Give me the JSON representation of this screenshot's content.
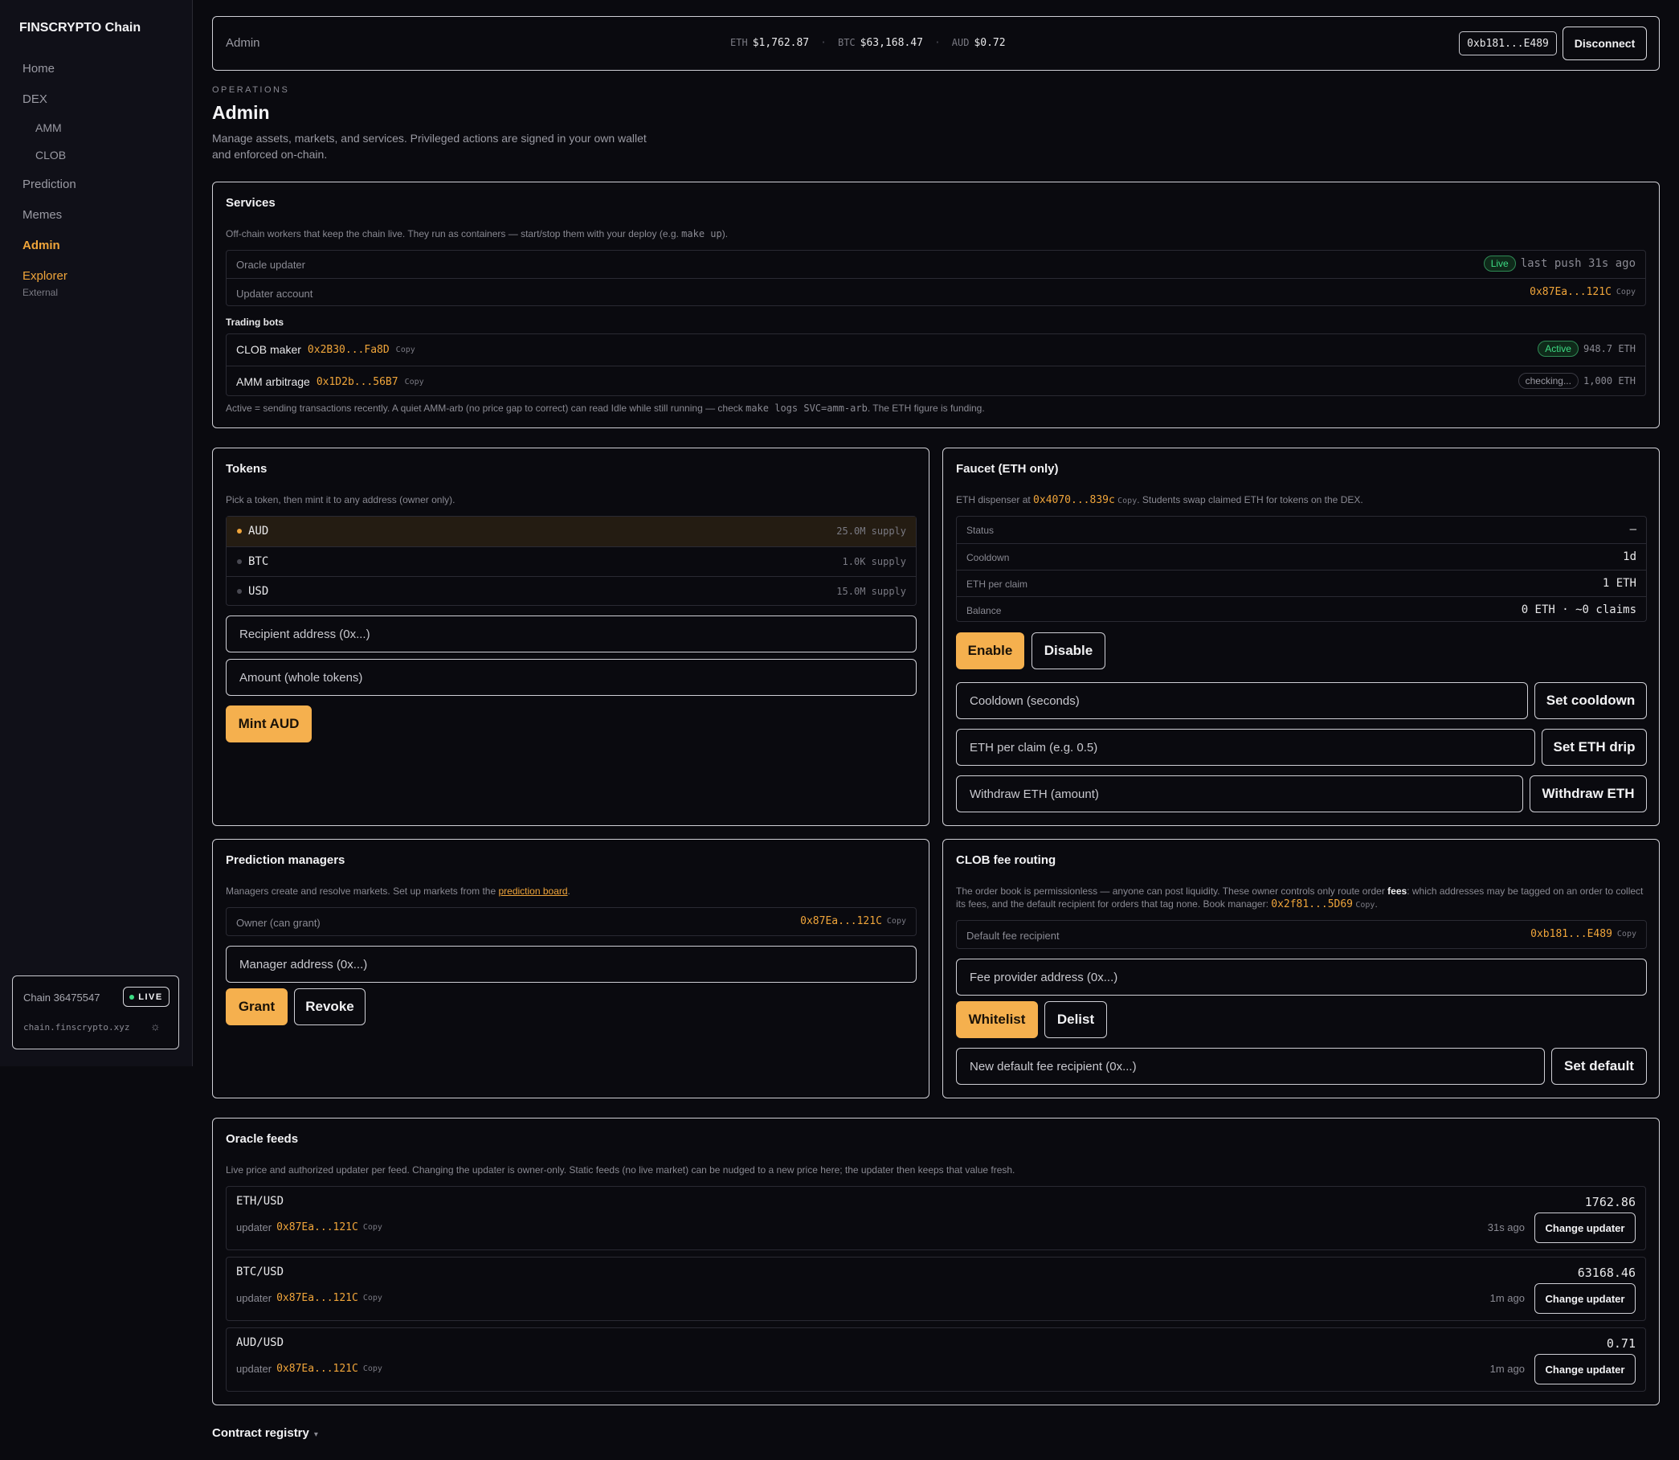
{
  "sidebar": {
    "brand": "FINSCRYPTO Chain",
    "items": [
      {
        "label": "Home"
      },
      {
        "label": "DEX"
      },
      {
        "label": "AMM"
      },
      {
        "label": "CLOB"
      },
      {
        "label": "Prediction"
      },
      {
        "label": "Memes"
      },
      {
        "label": "Admin"
      },
      {
        "label": "Explorer"
      }
    ],
    "explorer_sub": "External",
    "chain_label": "Chain 36475547",
    "live_label": "LIVE",
    "chain_host": "chain.finscrypto.xyz",
    "theme_icon": "sun-icon"
  },
  "header": {
    "title": "Admin",
    "tickers": [
      {
        "symbol": "ETH",
        "value": "$1,762.87"
      },
      {
        "symbol": "BTC",
        "value": "$63,168.47"
      },
      {
        "symbol": "AUD",
        "value": "$0.72"
      }
    ],
    "separator": "·",
    "wallet": "0xb181...E489",
    "disconnect": "Disconnect"
  },
  "page": {
    "eyebrow": "OPERATIONS",
    "title": "Admin",
    "description": "Manage assets, markets, and services. Privileged actions are signed in your own wallet and enforced on-chain."
  },
  "services": {
    "title": "Services",
    "desc_pre": "Off-chain workers that keep the chain live. They run as containers — start/stop them with your deploy (e.g. ",
    "desc_code": "make up",
    "desc_post": ").",
    "oracle_label": "Oracle updater",
    "oracle_badge": "Live",
    "oracle_status": "last push 31s ago",
    "account_label": "Updater account",
    "account_addr": "0x87Ea...121C",
    "copy": "Copy",
    "bots_title": "Trading bots",
    "bots": [
      {
        "name": "CLOB maker",
        "addr": "0x2B30...Fa8D",
        "badge": "Active",
        "funding": "948.7 ETH"
      },
      {
        "name": "AMM arbitrage",
        "addr": "0x1D2b...56B7",
        "badge": "checking...",
        "funding": "1,000 ETH"
      }
    ],
    "note_pre": "Active = sending transactions recently. A quiet AMM-arb (no price gap to correct) can read Idle while still running — check ",
    "note_code": "make logs SVC=amm-arb",
    "note_post": ". The ETH figure is funding."
  },
  "tokens": {
    "title": "Tokens",
    "desc": "Pick a token, then mint it to any address (owner only).",
    "list": [
      {
        "name": "AUD",
        "supply": "25.0M supply"
      },
      {
        "name": "BTC",
        "supply": "1.0K supply"
      },
      {
        "name": "USD",
        "supply": "15.0M supply"
      }
    ],
    "recipient_placeholder": "Recipient address (0x...)",
    "amount_placeholder": "Amount (whole tokens)",
    "mint_button": "Mint AUD"
  },
  "faucet": {
    "title": "Faucet (ETH only)",
    "desc_pre": "ETH dispenser at ",
    "addr": "0x4070...839c",
    "copy": "Copy",
    "desc_post": ". Students swap claimed ETH for tokens on the DEX.",
    "rows": [
      {
        "label": "Status",
        "value": "—"
      },
      {
        "label": "Cooldown",
        "value": "1d"
      },
      {
        "label": "ETH per claim",
        "value": "1 ETH"
      },
      {
        "label": "Balance",
        "value": "0 ETH · ~0 claims"
      }
    ],
    "enable": "Enable",
    "disable": "Disable",
    "cooldown_placeholder": "Cooldown (seconds)",
    "set_cooldown": "Set cooldown",
    "drip_placeholder": "ETH per claim (e.g. 0.5)",
    "set_drip": "Set ETH drip",
    "withdraw_placeholder": "Withdraw ETH (amount)",
    "withdraw": "Withdraw ETH"
  },
  "prediction": {
    "title": "Prediction managers",
    "desc_pre": "Managers create and resolve markets. Set up markets from the ",
    "desc_link": "prediction board",
    "desc_post": ".",
    "owner_label": "Owner (can grant)",
    "owner_addr": "0x87Ea...121C",
    "copy": "Copy",
    "manager_placeholder": "Manager address (0x...)",
    "grant": "Grant",
    "revoke": "Revoke"
  },
  "clob": {
    "title": "CLOB fee routing",
    "desc_pre": "The order book is permissionless — anyone can post liquidity. These owner controls only route order ",
    "desc_bold": "fees",
    "desc_mid": ": which addresses may be tagged on an order to collect its fees, and the default recipient for orders that tag none. Book manager: ",
    "manager_addr": "0x2f81...5D69",
    "copy": "Copy",
    "desc_post": ".",
    "default_label": "Default fee recipient",
    "default_addr": "0xb181...E489",
    "provider_placeholder": "Fee provider address (0x...)",
    "whitelist": "Whitelist",
    "delist": "Delist",
    "new_default_placeholder": "New default fee recipient (0x...)",
    "set_default": "Set default"
  },
  "oracle": {
    "title": "Oracle feeds",
    "desc": "Live price and authorized updater per feed. Changing the updater is owner-only. Static feeds (no live market) can be nudged to a new price here; the updater then keeps that value fresh.",
    "updater_label": "updater",
    "copy": "Copy",
    "change_button": "Change updater",
    "feeds": [
      {
        "pair": "ETH/USD",
        "price": "1762.86",
        "updater": "0x87Ea...121C",
        "ago": "31s ago"
      },
      {
        "pair": "BTC/USD",
        "price": "63168.46",
        "updater": "0x87Ea...121C",
        "ago": "1m ago"
      },
      {
        "pair": "AUD/USD",
        "price": "0.71",
        "updater": "0x87Ea...121C",
        "ago": "1m ago"
      }
    ]
  },
  "registry": {
    "title": "Contract registry",
    "chevron": "▾"
  },
  "colors": {
    "accent": "#f5b04e",
    "live_green": "#3ddc84",
    "background": "#0a0a0f"
  }
}
